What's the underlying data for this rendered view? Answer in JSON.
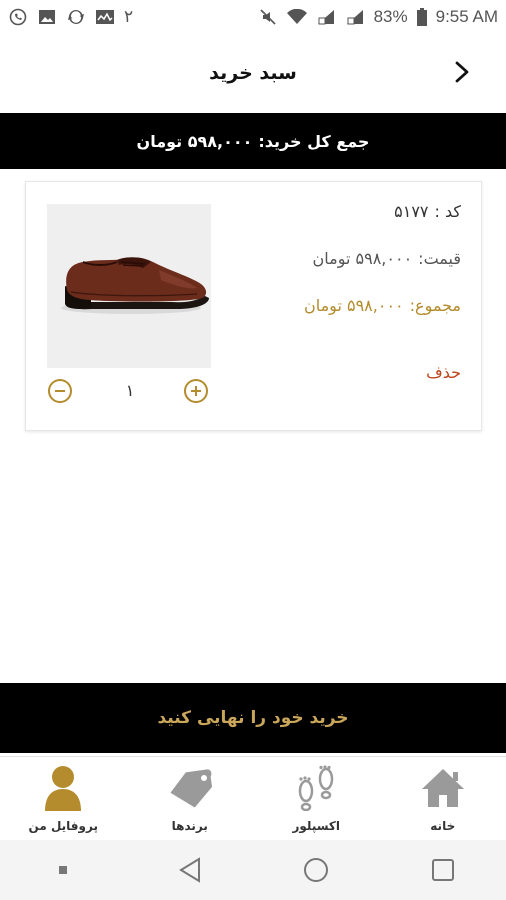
{
  "status_bar": {
    "notification_count": "۲",
    "battery_percent": "83%",
    "time": "9:55 AM",
    "icons_left": [
      "whatsapp-icon",
      "image-icon",
      "sync-icon",
      "activity-icon"
    ],
    "icons_right": [
      "mute-icon",
      "wifi-icon",
      "signal-icon",
      "signal-icon",
      "battery-icon"
    ]
  },
  "header": {
    "title": "سبد خرید",
    "back_icon": "chevron-right-icon"
  },
  "total": {
    "label": "جمع کل خرید:",
    "value": "۵۹۸,۰۰۰ تومان"
  },
  "cart_items": [
    {
      "code_label": "کد :",
      "code": "۵۱۷۷",
      "price_label": "قیمت:",
      "price": "۵۹۸,۰۰۰ تومان",
      "subtotal_label": "مجموع:",
      "subtotal": "۵۹۸,۰۰۰ تومان",
      "delete_label": "حذف",
      "quantity": "۱",
      "image": "brown-leather-shoe"
    }
  ],
  "checkout": {
    "label": "خرید خود را نهایی کنید"
  },
  "bottom_nav": {
    "items": [
      {
        "label": "خانه",
        "icon": "home-icon"
      },
      {
        "label": "اکسپلور",
        "icon": "footprints-icon"
      },
      {
        "label": "برندها",
        "icon": "tag-icon"
      },
      {
        "label": "پروفایل من",
        "icon": "user-icon",
        "active": true
      }
    ]
  },
  "colors": {
    "accent_gold": "#b48c2d",
    "delete_red": "#c0441c",
    "bar_black": "#000000"
  }
}
